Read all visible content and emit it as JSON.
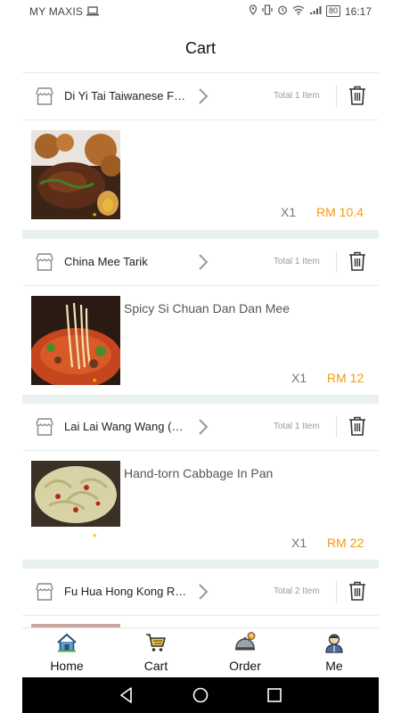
{
  "status_bar": {
    "carrier": "MY MAXIS",
    "battery": "80",
    "time": "16:17"
  },
  "header": {
    "title": "Cart"
  },
  "stores": [
    {
      "name": "Di Yi Tai Taiwanese Food",
      "total": "Total 1 Item",
      "item": {
        "name": "",
        "qty": "X1",
        "price": "RM 10.4"
      }
    },
    {
      "name": "China Mee Tarik",
      "total": "Total 1 Item",
      "item": {
        "name": "Spicy Si Chuan Dan Dan Mee",
        "qty": "X1",
        "price": "RM 12"
      }
    },
    {
      "name": "Lai Lai Wang Wang (Kuc...",
      "total": "Total 1 Item",
      "item": {
        "name": "Hand-torn Cabbage In Pan",
        "qty": "X1",
        "price": "RM 22"
      }
    },
    {
      "name": "Fu Hua Hong Kong Rest...",
      "total": "Total 2 Item"
    }
  ],
  "bottom_nav": [
    {
      "label": "Home",
      "icon": "home-icon"
    },
    {
      "label": "Cart",
      "icon": "cart-icon"
    },
    {
      "label": "Order",
      "icon": "order-icon"
    },
    {
      "label": "Me",
      "icon": "profile-icon"
    }
  ],
  "colors": {
    "price": "#f39a10",
    "gap": "#e8f0f0",
    "nav_bar": "#000000"
  }
}
